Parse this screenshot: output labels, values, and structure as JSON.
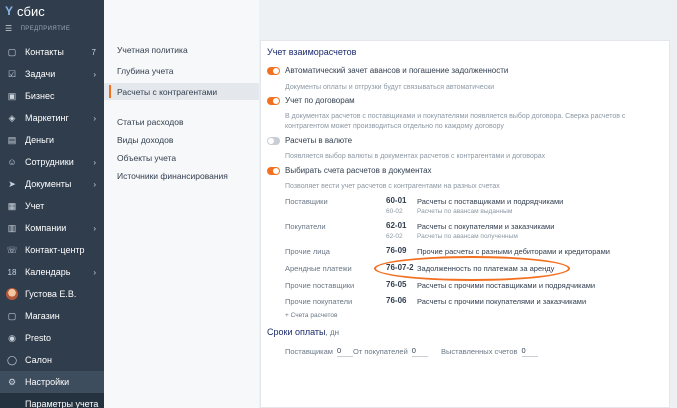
{
  "sidebar": {
    "logo": "сбис",
    "subtitle": "ПРЕДПРИЯТИЕ",
    "items": [
      {
        "label": "Контакты",
        "count": "7"
      },
      {
        "label": "Задачи",
        "chevron": "›"
      },
      {
        "label": "Бизнес"
      },
      {
        "label": "Маркетинг",
        "chevron": "›"
      },
      {
        "label": "Деньги"
      },
      {
        "label": "Сотрудники",
        "chevron": "›"
      },
      {
        "label": "Документы",
        "chevron": "›"
      },
      {
        "label": "Учет"
      },
      {
        "label": "Компании",
        "chevron": "›"
      },
      {
        "label": "Контакт-центр"
      },
      {
        "label": "Календарь",
        "count_left": "18",
        "chevron": "›"
      },
      {
        "label": "Густова Е.В."
      },
      {
        "label": "Магазин"
      },
      {
        "label": "Presto"
      },
      {
        "label": "Салон"
      },
      {
        "label": "Настройки"
      },
      {
        "label": "Параметры учета"
      }
    ]
  },
  "middle": {
    "group1": [
      "Учетная политика",
      "Глубина учета",
      "Расчеты с контрагентами"
    ],
    "group2": [
      "Статьи расходов",
      "Виды доходов",
      "Объекты учета",
      "Источники финансирования"
    ]
  },
  "main": {
    "title": "Учет взаиморасчетов",
    "opt1": {
      "label": "Автоматический зачет авансов и погашение задолженности",
      "hint": "Документы оплаты и отгрузки будут связываться автоматически"
    },
    "opt2": {
      "label": "Учет по договорам",
      "hint1": "В документах расчетов с поставщиками и покупателями появляется выбор договора. Сверка расчетов с",
      "hint2": "контрагентом может производиться отдельно по каждому договору"
    },
    "opt3": {
      "label": "Расчеты в валюте",
      "hint": "Появляется выбор валюты в документах расчетов с контрагентами и договорах"
    },
    "opt4": {
      "label": "Выбирать счета расчетов в документах",
      "hint": "Позволяет вести учет расчетов с контрагентами на разных счетах"
    },
    "accounts": [
      {
        "label": "Поставщики",
        "code": "60-01",
        "desc": "Расчеты с поставщиками и подрядчиками",
        "subcode": "60-02",
        "subdesc": "Расчеты по авансам выданным"
      },
      {
        "label": "Покупатели",
        "code": "62-01",
        "desc": "Расчеты с покупателями и заказчиками",
        "subcode": "62-02",
        "subdesc": "Расчеты по авансам полученным"
      },
      {
        "label": "Прочие лица",
        "code": "76-09",
        "desc": "Прочие расчеты с разными дебиторами и кредиторами"
      },
      {
        "label": "Арендные платежи",
        "code": "76-07-2",
        "desc": "Задолженность по платежам за аренду"
      },
      {
        "label": "Прочие поставщики",
        "code": "76-05",
        "desc": "Расчеты с прочими поставщиками и подрядчиками"
      },
      {
        "label": "Прочие покупатели",
        "code": "76-06",
        "desc": "Расчеты с прочими покупателями и заказчиками"
      }
    ],
    "add_account": "+ Счета расчетов",
    "due_title": "Сроки оплаты",
    "due_unit": ", дн",
    "due": [
      {
        "label": "Поставщикам",
        "value": "0"
      },
      {
        "label": "От покупателей",
        "value": "0"
      },
      {
        "label": "Выставленных счетов",
        "value": "0"
      }
    ]
  },
  "colors": {
    "accent": "#f37021",
    "sidebar": "#2f3d4d",
    "title": "#1a2a6c"
  }
}
